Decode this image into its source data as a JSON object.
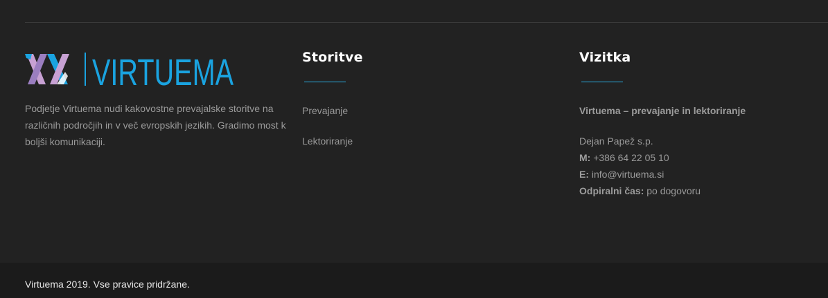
{
  "brand": {
    "logo_text": "VIRTUEMA",
    "colors": {
      "blue": "#1aa3e0",
      "purple": "#9b7ec0",
      "pink": "#c7a1d3"
    }
  },
  "about": {
    "text": "Podjetje Virtuema nudi kakovostne prevajalske storitve na različnih področjih in v več evropskih jezikih. Gradimo most k boljši komunikaciji."
  },
  "services": {
    "title": "Storitve",
    "links": [
      "Prevajanje",
      "Lektoriranje"
    ]
  },
  "vcard": {
    "title": "Vizitka",
    "company": "Virtuema – prevajanje in lektoriranje",
    "owner": "Dejan Papež s.p.",
    "phone_label": "M:",
    "phone": "+386 64 22 05 10",
    "email_label": "E:",
    "email": "info@virtuema.si",
    "hours_label": "Odpiralni čas:",
    "hours": "po dogovoru"
  },
  "footer": {
    "copyright": "Virtuema 2019. Vse pravice pridržane."
  },
  "accent_color": "#2ab0e6"
}
